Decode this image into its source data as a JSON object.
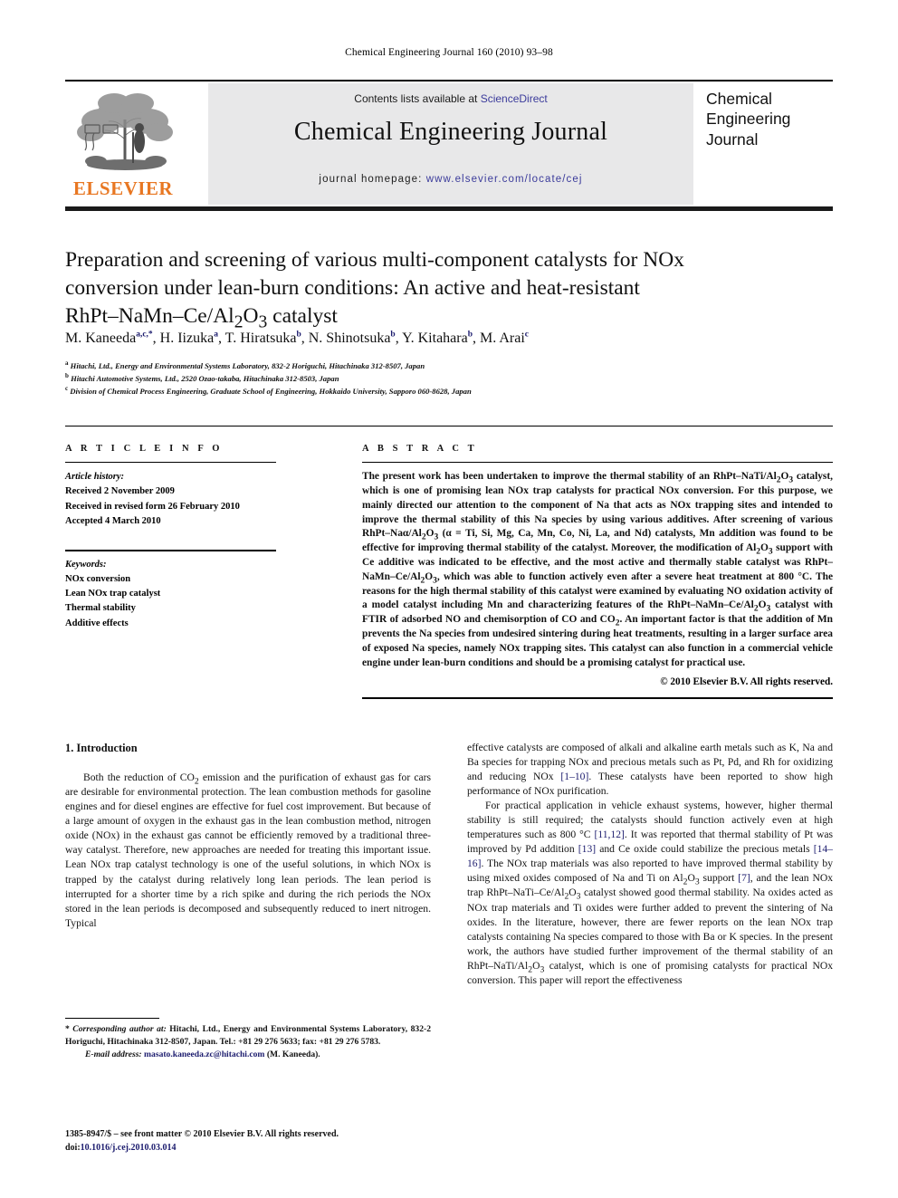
{
  "running_head": "Chemical Engineering Journal 160 (2010) 93–98",
  "masthead": {
    "contents_prefix": "Contents lists available at ",
    "sciencedirect": "ScienceDirect",
    "journal_title": "Chemical Engineering Journal",
    "homepage_prefix": "journal homepage: ",
    "homepage_url": "www.elsevier.com/locate/cej",
    "publisher_word": "ELSEVIER",
    "publisher_color": "#e87722",
    "link_color": "#3b3b9b",
    "band_color": "#e8e8e9",
    "cover_lines": [
      "Chemical",
      "Engineering",
      "Journal"
    ]
  },
  "article": {
    "title_line1": "Preparation and screening of various multi-component catalysts for NOx",
    "title_line2": "conversion under lean-burn conditions: An active and heat-resistant",
    "title_line3_pre": "RhPt–NaMn–Ce/Al",
    "title_line3_sub1": "2",
    "title_line3_mid": "O",
    "title_line3_sub2": "3",
    "title_line3_post": " catalyst",
    "authors": [
      {
        "name": "M. Kaneeda",
        "marks": "a,c,*"
      },
      {
        "name": "H. Iizuka",
        "marks": "a"
      },
      {
        "name": "T. Hiratsuka",
        "marks": "b"
      },
      {
        "name": "N. Shinotsuka",
        "marks": "b"
      },
      {
        "name": "Y. Kitahara",
        "marks": "b"
      },
      {
        "name": "M. Arai",
        "marks": "c"
      }
    ],
    "affiliations": [
      {
        "mark": "a",
        "text": "Hitachi, Ltd., Energy and Environmental Systems Laboratory, 832-2 Horiguchi, Hitachinaka 312-8507, Japan"
      },
      {
        "mark": "b",
        "text": "Hitachi Automotive Systems, Ltd., 2520 Ozao-takaba, Hitachinaka 312-8503, Japan"
      },
      {
        "mark": "c",
        "text": "Division of Chemical Process Engineering, Graduate School of Engineering, Hokkaido University, Sapporo 060-8628, Japan"
      }
    ]
  },
  "article_info": {
    "heading": "A R T I C L E   I N F O",
    "history_label": "Article history:",
    "history": [
      "Received 2 November 2009",
      "Received in revised form 26 February 2010",
      "Accepted 4 March 2010"
    ],
    "keywords_label": "Keywords:",
    "keywords": [
      "NOx conversion",
      "Lean NOx trap catalyst",
      "Thermal stability",
      "Additive effects"
    ]
  },
  "abstract": {
    "heading": "A B S T R A C T",
    "paragraph_html": "The present work has been undertaken to improve the thermal stability of an RhPt–NaTi/Al<sub>2</sub>O<sub>3</sub> catalyst, which is one of promising lean NOx trap catalysts for practical NOx conversion. For this purpose, we mainly directed our attention to the component of Na that acts as NOx trapping sites and intended to improve the thermal stability of this Na species by using various additives. After screening of various RhPt–Naα/Al<sub>2</sub>O<sub>3</sub> (α = Ti, Si, Mg, Ca, Mn, Co, Ni, La, and Nd) catalysts, Mn addition was found to be effective for improving thermal stability of the catalyst. Moreover, the modification of Al<sub>2</sub>O<sub>3</sub> support with Ce additive was indicated to be effective, and the most active and thermally stable catalyst was RhPt–NaMn–Ce/Al<sub>2</sub>O<sub>3</sub>, which was able to function actively even after a severe heat treatment at 800 °C. The reasons for the high thermal stability of this catalyst were examined by evaluating NO oxidation activity of a model catalyst including Mn and characterizing features of the RhPt–NaMn–Ce/Al<sub>2</sub>O<sub>3</sub> catalyst with FTIR of adsorbed NO and chemisorption of CO and CO<sub>2</sub>. An important factor is that the addition of Mn prevents the Na species from undesired sintering during heat treatments, resulting in a larger surface area of exposed Na species, namely NOx trapping sites. This catalyst can also function in a commercial vehicle engine under lean-burn conditions and should be a promising catalyst for practical use.",
    "copyright": "© 2010 Elsevier B.V. All rights reserved."
  },
  "introduction": {
    "heading": "1.  Introduction",
    "left_p1_html": "Both the reduction of CO<sub>2</sub> emission and the purification of exhaust gas for cars are desirable for environmental protection. The lean combustion methods for gasoline engines and for diesel engines are effective for fuel cost improvement. But because of a large amount of oxygen in the exhaust gas in the lean combustion method, nitrogen oxide (NOx) in the exhaust gas cannot be efficiently removed by a traditional three-way catalyst. Therefore, new approaches are needed for treating this important issue. Lean NOx trap catalyst technology is one of the useful solutions, in which NOx is trapped by the catalyst during relatively long lean periods. The lean period is interrupted for a shorter time by a rich spike and during the rich periods the NOx stored in the lean periods is decomposed and subsequently reduced to inert nitrogen. Typical",
    "right_p1_html": "effective catalysts are composed of alkali and alkaline earth metals such as K, Na and Ba species for trapping NOx and precious metals such as Pt, Pd, and Rh for oxidizing and reducing NOx <span class=\"ref\">[1–10]</span>. These catalysts have been reported to show high performance of NOx purification.",
    "right_p2_html": "For practical application in vehicle exhaust systems, however, higher thermal stability is still required; the catalysts should function actively even at high temperatures such as 800 °C <span class=\"ref\">[11,12]</span>. It was reported that thermal stability of Pt was improved by Pd addition <span class=\"ref\">[13]</span> and Ce oxide could stabilize the precious metals <span class=\"ref\">[14–16]</span>. The NOx trap materials was also reported to have improved thermal stability by using mixed oxides composed of Na and Ti on Al<sub>2</sub>O<sub>3</sub> support <span class=\"ref\">[7]</span>, and the lean NOx trap RhPt–NaTi–Ce/Al<sub>2</sub>O<sub>3</sub> catalyst showed good thermal stability. Na oxides acted as NOx trap materials and Ti oxides were further added to prevent the sintering of Na oxides. In the literature, however, there are fewer reports on the lean NOx trap catalysts containing Na species compared to those with Ba or K species. In the present work, the authors have studied further improvement of the thermal stability of an RhPt–NaTi/Al<sub>2</sub>O<sub>3</sub> catalyst, which is one of promising catalysts for practical NOx conversion. This paper will report the effectiveness"
  },
  "footnotes": {
    "corresponding_html": "* <i>Corresponding author at:</i> Hitachi, Ltd., Energy and Environmental Systems Laboratory, 832-2 Horiguchi, Hitachinaka 312-8507, Japan. Tel.: +81 29 276 5633; fax: +81 29 276 5783.",
    "email_label": "E-mail address:",
    "email": "masato.kaneeda.zc@hitachi.com",
    "email_suffix": " (M. Kaneeda).",
    "issn_line": "1385-8947/$ – see front matter © 2010 Elsevier B.V. All rights reserved.",
    "doi_label": "doi:",
    "doi_value": "10.1016/j.cej.2010.03.014"
  }
}
